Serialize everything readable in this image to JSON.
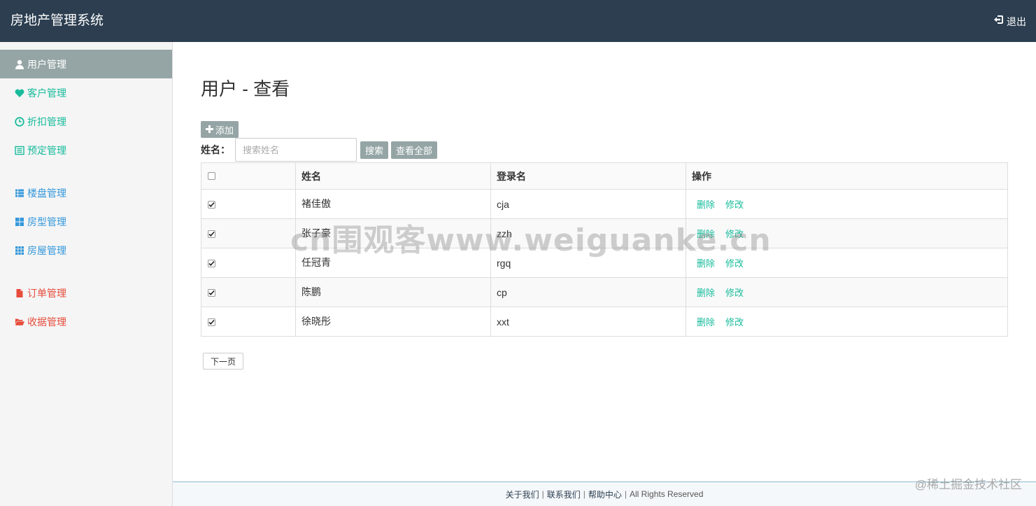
{
  "app": {
    "title": "房地产管理系统",
    "logout_label": "退出"
  },
  "sidebar": {
    "items": [
      {
        "label": "用户管理",
        "icon": "user-icon",
        "color": "#ffffff",
        "active": true
      },
      {
        "label": "客户管理",
        "icon": "heart-icon",
        "color": "#18bc9c"
      },
      {
        "label": "折扣管理",
        "icon": "clock-icon",
        "color": "#18bc9c"
      },
      {
        "label": "预定管理",
        "icon": "list-alt-icon",
        "color": "#18bc9c"
      },
      {
        "label": "楼盘管理",
        "icon": "list-icon",
        "color": "#3498db"
      },
      {
        "label": "房型管理",
        "icon": "th-large-icon",
        "color": "#3498db"
      },
      {
        "label": "房屋管理",
        "icon": "th-icon",
        "color": "#3498db"
      },
      {
        "label": "订单管理",
        "icon": "file-icon",
        "color": "#e74c3c"
      },
      {
        "label": "收据管理",
        "icon": "folder-open-icon",
        "color": "#e74c3c"
      }
    ]
  },
  "main": {
    "title": "用户 - 查看",
    "add_label": "添加",
    "search": {
      "label": "姓名：",
      "placeholder": "搜索姓名",
      "search_label": "搜索",
      "view_all_label": "查看全部"
    },
    "table": {
      "headers": [
        "姓名",
        "登录名",
        "操作"
      ],
      "rows": [
        {
          "name": "褚佳傲",
          "login": "cja",
          "checked": true
        },
        {
          "name": "张子豪",
          "login": "zzh",
          "checked": true
        },
        {
          "name": "任冠青",
          "login": "rgq",
          "checked": true
        },
        {
          "name": "陈鹏",
          "login": "cp",
          "checked": true
        },
        {
          "name": "徐晓彤",
          "login": "xxt",
          "checked": true
        }
      ],
      "delete_label": "删除",
      "edit_label": "修改"
    },
    "next_page_label": "下一页"
  },
  "footer": {
    "about": "关于我们",
    "contact": "联系我们",
    "help": "帮助中心",
    "rights": "All Rights Reserved",
    "separator": "|"
  },
  "watermark": "cn围观客www.weiguanke.cn",
  "credit": "@稀土掘金技术社区",
  "colors": {
    "navbar": "#2c3e50",
    "active": "#95a5a6",
    "green": "#18bc9c",
    "blue": "#3498db",
    "red": "#e74c3c"
  }
}
